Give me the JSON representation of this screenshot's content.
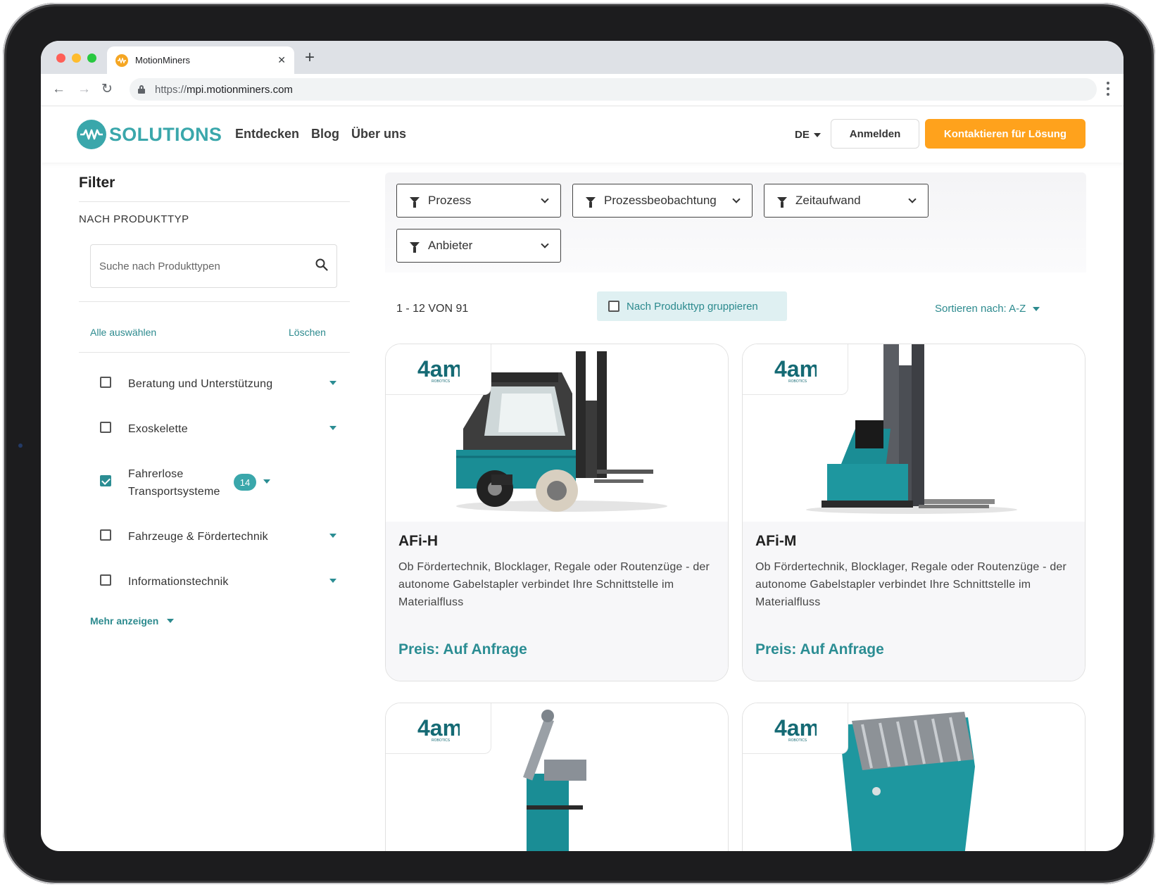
{
  "browser": {
    "tab_title": "MotionMiners",
    "url_protocol": "https://",
    "url_host": "mpi.motionminers.com"
  },
  "header": {
    "logo_text": "SOLUTIONS",
    "nav": [
      "Entdecken",
      "Blog",
      "Über uns"
    ],
    "language": "DE",
    "login_label": "Anmelden",
    "contact_label": "Kontaktieren für Lösung",
    "accent_color": "#ffa21c",
    "brand_color": "#3aa7ab"
  },
  "sidebar": {
    "title": "Filter",
    "section_title": "NACH PRODUKTTYP",
    "search_placeholder": "Suche nach Produkttypen",
    "select_all": "Alle auswählen",
    "clear": "Löschen",
    "categories": [
      {
        "label": "Beratung und Unterstützung",
        "checked": false
      },
      {
        "label": "Exoskelette",
        "checked": false
      },
      {
        "label": "Fahrerlose Transportsysteme",
        "checked": true,
        "count": "14"
      },
      {
        "label": "Fahrzeuge & Fördertechnik",
        "checked": false
      },
      {
        "label": "Informationstechnik",
        "checked": false
      }
    ],
    "show_more": "Mehr anzeigen"
  },
  "filters": {
    "dropdowns": [
      "Prozess",
      "Prozessbeobachtung",
      "Zeitaufwand",
      "Anbieter"
    ]
  },
  "results": {
    "count": "1 - 12 VON 91",
    "group_label": "Nach Produkttyp gruppieren",
    "sort_label": "Sortieren nach: A-Z"
  },
  "products": [
    {
      "brand": "4am",
      "brand_sub": "ROBOTICS",
      "title": "AFi-H",
      "description": "Ob Fördertechnik, Blocklager, Regale oder Routenzüge - der autonome Gabelstapler verbindet Ihre Schnittstelle im Materialfluss",
      "price": "Preis: Auf Anfrage"
    },
    {
      "brand": "4am",
      "brand_sub": "ROBOTICS",
      "title": "AFi-M",
      "description": "Ob Fördertechnik, Blocklager, Regale oder Routenzüge - der autonome Gabelstapler verbindet Ihre Schnittstelle im Materialfluss",
      "price": "Preis: Auf Anfrage"
    },
    {
      "brand": "4am",
      "brand_sub": "ROBOTICS"
    },
    {
      "brand": "4am",
      "brand_sub": "ROBOTICS"
    }
  ]
}
